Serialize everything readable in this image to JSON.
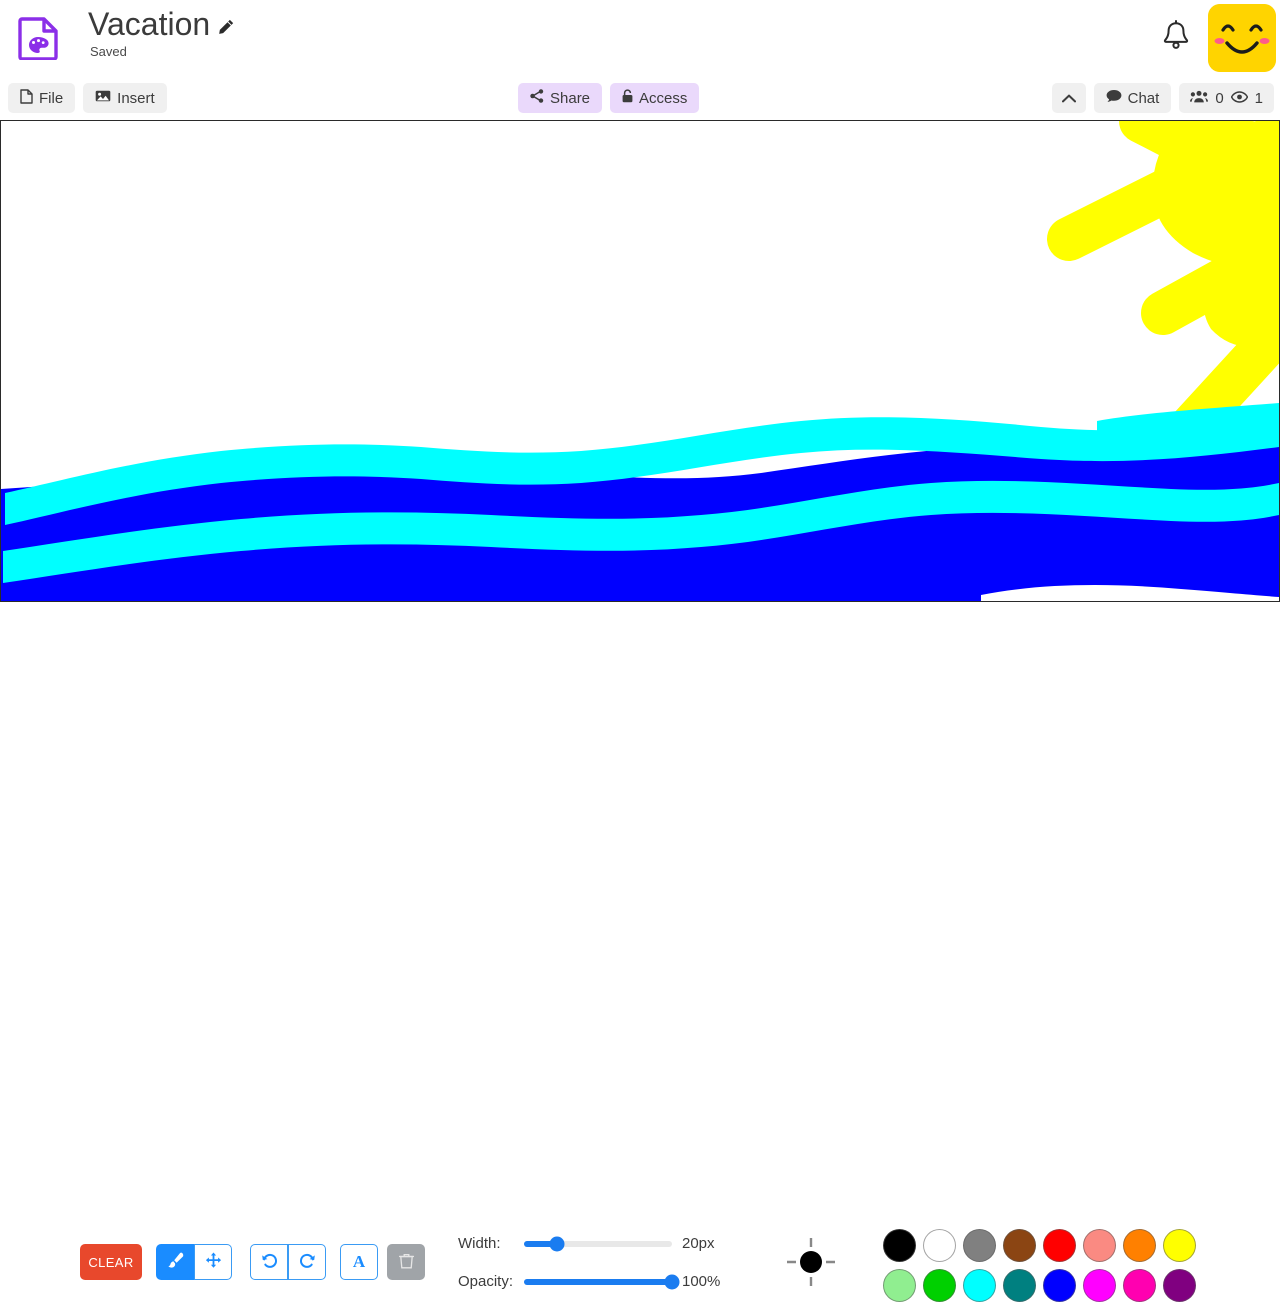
{
  "header": {
    "doc_icon": "document-palette-icon",
    "title": "Vacation",
    "edit_icon": "pencil-icon",
    "status": "Saved",
    "bell_icon": "bell-icon",
    "avatar_icon": "smiley-avatar"
  },
  "menubar": {
    "file_label": "File",
    "file_icon": "file-icon",
    "insert_label": "Insert",
    "insert_icon": "image-icon",
    "share_label": "Share",
    "share_icon": "share-nodes-icon",
    "access_label": "Access",
    "access_icon": "lock-icon",
    "collapse_icon": "chevron-up-icon",
    "chat_label": "Chat",
    "chat_icon": "comment-icon",
    "users_icon": "users-group-icon",
    "users_count": "0",
    "viewers_icon": "eye-icon",
    "viewers_count": "1"
  },
  "toolbar": {
    "clear_label": "CLEAR",
    "brush_tool": "brush-icon",
    "move_tool": "move-arrows-icon",
    "undo_tool": "undo-icon",
    "redo_tool": "redo-icon",
    "text_tool": "A",
    "delete_tool": "trash-icon",
    "width_label": "Width:",
    "width_value": "20px",
    "width_percent": 22,
    "opacity_label": "Opacity:",
    "opacity_value": "100%",
    "opacity_percent": 100,
    "brush_preview_color": "#000000"
  },
  "palette": {
    "colors": [
      {
        "name": "black",
        "hex": "#000000"
      },
      {
        "name": "white",
        "hex": "#ffffff"
      },
      {
        "name": "gray",
        "hex": "#808080"
      },
      {
        "name": "brown",
        "hex": "#8b4513"
      },
      {
        "name": "red",
        "hex": "#ff0000"
      },
      {
        "name": "salmon",
        "hex": "#fa8a82"
      },
      {
        "name": "orange",
        "hex": "#ff8000"
      },
      {
        "name": "yellow",
        "hex": "#ffff00"
      },
      {
        "name": "light-green",
        "hex": "#90ee90"
      },
      {
        "name": "green",
        "hex": "#00d000"
      },
      {
        "name": "cyan",
        "hex": "#00ffff"
      },
      {
        "name": "teal",
        "hex": "#008080"
      },
      {
        "name": "blue",
        "hex": "#0000ff"
      },
      {
        "name": "magenta",
        "hex": "#ff00ff"
      },
      {
        "name": "pink",
        "hex": "#ff00b0"
      },
      {
        "name": "purple",
        "hex": "#800080"
      }
    ]
  },
  "canvas": {
    "background": "#ffffff",
    "drawing": {
      "sun_color": "#ffff00",
      "water_color": "#0000ff",
      "wave_color": "#00ffff"
    }
  }
}
